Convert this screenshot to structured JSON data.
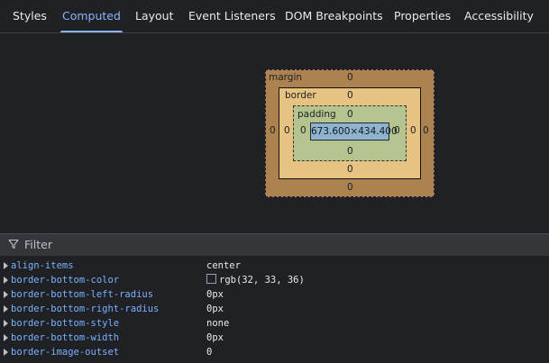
{
  "tabs": [
    {
      "label": "Styles"
    },
    {
      "label": "Computed"
    },
    {
      "label": "Layout"
    },
    {
      "label": "Event Listeners"
    },
    {
      "label": "DOM Breakpoints"
    },
    {
      "label": "Properties"
    },
    {
      "label": "Accessibility"
    }
  ],
  "active_tab": "Computed",
  "box_model": {
    "margin_label": "margin",
    "margin_top": "0",
    "margin_right": "0",
    "margin_bottom": "0",
    "margin_left": "0",
    "border_label": "border",
    "border_top": "0",
    "border_right": "0",
    "border_bottom": "0",
    "border_left": "0",
    "padding_label": "padding",
    "padding_top": "0",
    "padding_right": "0",
    "padding_bottom": "0",
    "padding_left": "0",
    "content_size": "673.600×434.400",
    "colors": {
      "margin": "#ad8251",
      "border": "#e7c382",
      "padding": "#b5c48e",
      "content": "#8fb3cc"
    }
  },
  "filter": {
    "label": "Filter",
    "icon": "filter-icon"
  },
  "properties": [
    {
      "name": "align-items",
      "value": "center",
      "swatch": false
    },
    {
      "name": "border-bottom-color",
      "value": "rgb(32, 33, 36)",
      "swatch": true
    },
    {
      "name": "border-bottom-left-radius",
      "value": "0px",
      "swatch": false
    },
    {
      "name": "border-bottom-right-radius",
      "value": "0px",
      "swatch": false
    },
    {
      "name": "border-bottom-style",
      "value": "none",
      "swatch": false
    },
    {
      "name": "border-bottom-width",
      "value": "0px",
      "swatch": false
    },
    {
      "name": "border-image-outset",
      "value": "0",
      "swatch": false
    }
  ],
  "theme": {
    "accent": "#8ab4f8",
    "prop_name_color": "#7ab1ff",
    "background": "#202124"
  }
}
